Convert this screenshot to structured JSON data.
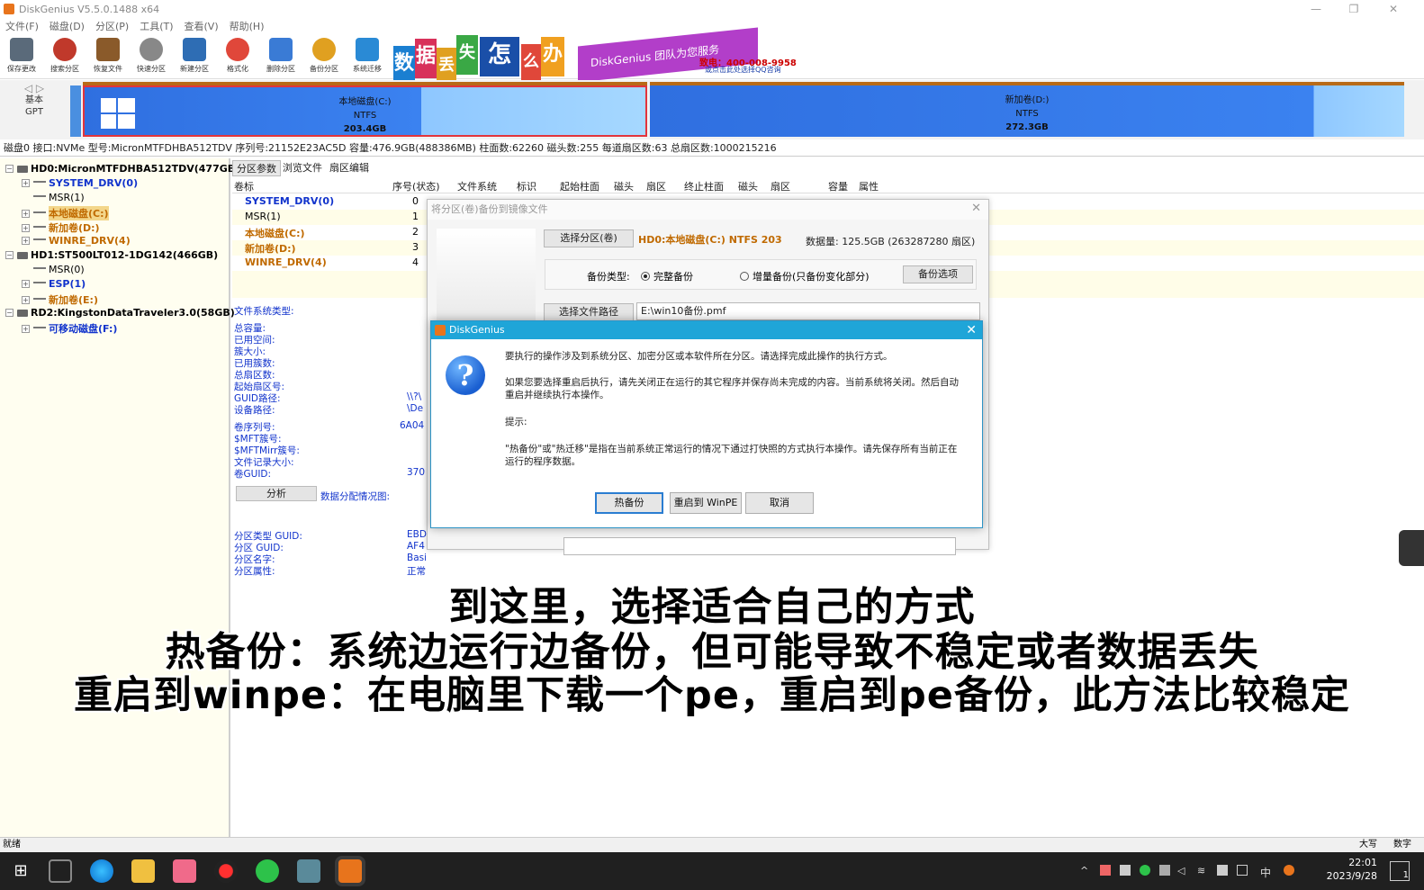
{
  "window": {
    "title": "DiskGenius V5.5.0.1488 x64",
    "minimize": "—",
    "maximize": "❐",
    "close": "✕"
  },
  "menu": [
    "文件(F)",
    "磁盘(D)",
    "分区(P)",
    "工具(T)",
    "查看(V)",
    "帮助(H)"
  ],
  "toolbar": [
    {
      "label": "保存更改",
      "icon": "save-icon",
      "color": "#5a6a7a"
    },
    {
      "label": "搜索分区",
      "icon": "search-icon",
      "color": "#c0392b"
    },
    {
      "label": "恢复文件",
      "icon": "recover-icon",
      "color": "#8a5a2a"
    },
    {
      "label": "快速分区",
      "icon": "quick-partition-icon",
      "color": "#888888"
    },
    {
      "label": "新建分区",
      "icon": "new-partition-icon",
      "color": "#2e6db4"
    },
    {
      "label": "格式化",
      "icon": "format-icon",
      "color": "#e0473a"
    },
    {
      "label": "删除分区",
      "icon": "delete-icon",
      "color": "#3a7bd5"
    },
    {
      "label": "备份分区",
      "icon": "backup-icon",
      "color": "#e0a020"
    },
    {
      "label": "系统迁移",
      "icon": "migrate-icon",
      "color": "#2a8ad5"
    }
  ],
  "banner": {
    "tiles": [
      "数",
      "据",
      "丢",
      "失",
      "怎",
      "么",
      "办"
    ],
    "slogan": "DiskGenius 团队为您服务",
    "phone": "致电：400-008-9958",
    "qq": "或点击此处选择QQ咨询"
  },
  "diskmap": {
    "meta_top": "基本",
    "meta_bottom": "GPT",
    "c": {
      "name": "本地磁盘(C:)",
      "fs": "NTFS",
      "size": "203.4GB"
    },
    "d": {
      "name": "新加卷(D:)",
      "fs": "NTFS",
      "size": "272.3GB"
    }
  },
  "diskinfo": "磁盘0 接口:NVMe  型号:MicronMTFDHBA512TDV  序列号:21152E23AC5D  容量:476.9GB(488386MB)  柱面数:62260  磁头数:255  每道扇区数:63  总扇区数:1000215216",
  "tree": [
    {
      "label": "HD0:MicronMTFDHBA512TDV(477GB)",
      "level": 0,
      "type": "disk"
    },
    {
      "label": "SYSTEM_DRV(0)",
      "level": 1,
      "type": "blue"
    },
    {
      "label": "MSR(1)",
      "level": 1,
      "type": "plain"
    },
    {
      "label": "本地磁盘(C:)",
      "level": 1,
      "type": "selected"
    },
    {
      "label": "新加卷(D:)",
      "level": 1,
      "type": "orange"
    },
    {
      "label": "WINRE_DRV(4)",
      "level": 1,
      "type": "orange"
    },
    {
      "label": "HD1:ST500LT012-1DG142(466GB)",
      "level": 0,
      "type": "disk"
    },
    {
      "label": "MSR(0)",
      "level": 1,
      "type": "plain"
    },
    {
      "label": "ESP(1)",
      "level": 1,
      "type": "blue"
    },
    {
      "label": "新加卷(E:)",
      "level": 1,
      "type": "orange"
    },
    {
      "label": "RD2:KingstonDataTraveler3.0(58GB)",
      "level": 0,
      "type": "disk"
    },
    {
      "label": "可移动磁盘(F:)",
      "level": 1,
      "type": "blue"
    }
  ],
  "tabs": [
    "分区参数",
    "浏览文件",
    "扇区编辑"
  ],
  "table": {
    "headers": [
      "卷标",
      "序号(状态)",
      "文件系统",
      "标识",
      "起始柱面",
      "磁头",
      "扇区",
      "终止柱面",
      "磁头",
      "扇区",
      "容量",
      "属性"
    ],
    "rows": [
      {
        "name": "SYSTEM_DRV(0)",
        "idx": "0",
        "color": "blue"
      },
      {
        "name": "MSR(1)",
        "idx": "1",
        "color": "plain"
      },
      {
        "name": "本地磁盘(C:)",
        "idx": "2",
        "color": "orange"
      },
      {
        "name": "新加卷(D:)",
        "idx": "3",
        "color": "orange"
      },
      {
        "name": "WINRE_DRV(4)",
        "idx": "4",
        "color": "orange"
      }
    ]
  },
  "info": {
    "fs_type_label": "文件系统类型:",
    "labels1": [
      "总容量:",
      "已用空间:",
      "簇大小:",
      "已用簇数:",
      "总扇区数:",
      "起始扇区号:",
      "GUID路径:",
      "设备路径:"
    ],
    "values1": [
      "",
      "",
      "",
      "",
      "",
      "",
      "\\\\?\\",
      "\\De"
    ],
    "labels2": [
      "卷序列号:",
      "$MFT簇号:",
      "$MFTMirr簇号:",
      "文件记录大小:",
      "卷GUID:"
    ],
    "values2": [
      "6A04",
      "",
      "",
      "",
      "370"
    ],
    "analyze": "分析",
    "alloc_label": "数据分配情况图:",
    "labels3": [
      "分区类型 GUID:",
      "分区 GUID:",
      "分区名字:",
      "分区属性:"
    ],
    "values3": [
      "EBD",
      "AF4",
      "Basi",
      "正常"
    ]
  },
  "backup_dialog": {
    "title": "将分区(卷)备份到镜像文件",
    "select_partition": "选择分区(卷)",
    "partition_value": "HD0:本地磁盘(C:) NTFS 203",
    "data_size": "数据量: 125.5GB (263287280 扇区)",
    "backup_type_label": "备份类型:",
    "full": "完整备份",
    "incremental": "增量备份(只备份变化部分)",
    "options": "备份选项",
    "select_path": "选择文件路径",
    "path_value": "E:\\win10备份.pmf"
  },
  "modal": {
    "title": "DiskGenius",
    "line1": "要执行的操作涉及到系统分区、加密分区或本软件所在分区。请选择完成此操作的执行方式。",
    "line2": "如果您要选择重启后执行，请先关闭正在运行的其它程序并保存尚未完成的内容。当前系统将关闭。然后自动重启并继续执行本操作。",
    "hint": "提示:",
    "line3": "\"热备份\"或\"热迁移\"是指在当前系统正常运行的情况下通过打快照的方式执行本操作。请先保存所有当前正在运行的程序数据。",
    "btn_hot": "热备份",
    "btn_winpe": "重启到 WinPE",
    "btn_cancel": "取消"
  },
  "subtitles": [
    "到这里，选择适合自己的方式",
    "热备份：系统边运行边备份，但可能导致不稳定或者数据丢失",
    "重启到winpe：在电脑里下载一个pe，重启到pe备份，此方法比较稳定"
  ],
  "status": {
    "left": "就绪",
    "caps": "大写",
    "num": "数字"
  },
  "taskbar": {
    "time": "22:01",
    "date": "2023/9/28",
    "ime": "中",
    "notify": "1"
  }
}
